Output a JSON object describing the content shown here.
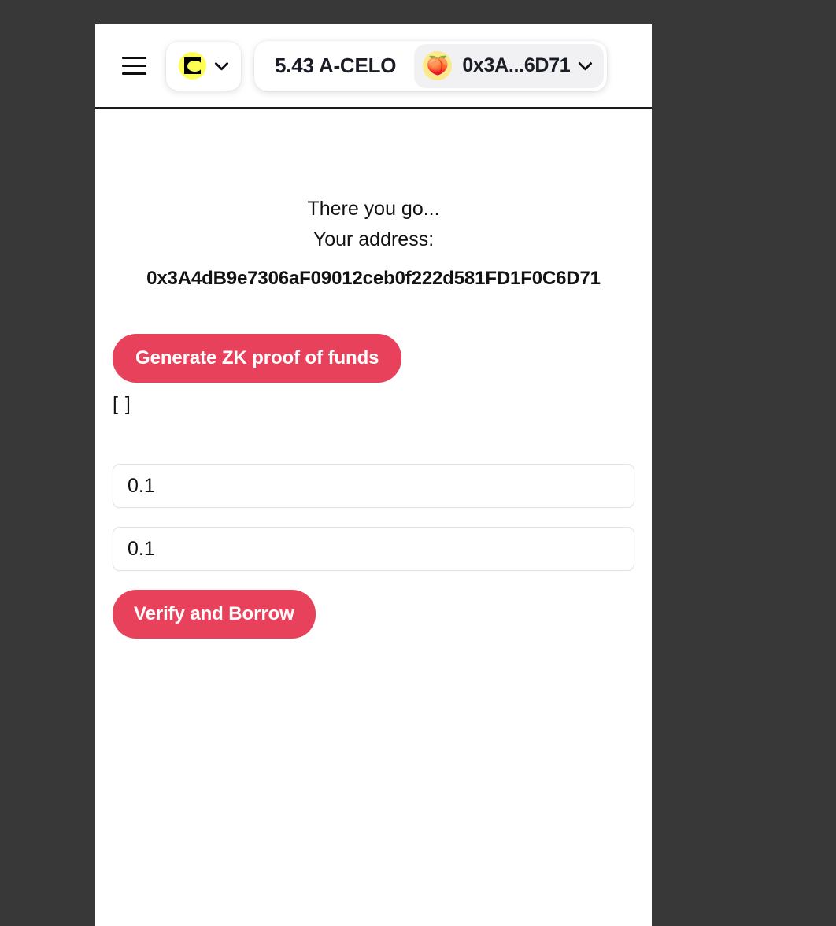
{
  "theme": {
    "page_background": "#FFFFFF",
    "outer_background": "#383838",
    "accent_red": "#E8415C",
    "celo_yellow": "#FCFF52",
    "chip_gray": "#F1F1F3",
    "avatar_yellow": "#FCE98A"
  },
  "header": {
    "menu_button_label": "Menu",
    "menu_icon": "hamburger-icon",
    "network": {
      "logo_icon": "celo-logo-icon",
      "name": "Celo",
      "dropdown_icon": "chevron-down-icon"
    },
    "wallet": {
      "balance": "5.43 A-CELO",
      "avatar_icon": "peach-emoji-avatar",
      "avatar_glyph": "🍑",
      "address_short": "0x3A...6D71",
      "dropdown_icon": "chevron-down-icon"
    }
  },
  "main": {
    "headline_line1": "There you go...",
    "headline_line2": "Your address:",
    "address_full": "0x3A4dB9e7306aF09012ceb0f222d581FD1F0C6D71",
    "generate_proof_label": "Generate ZK proof of funds",
    "proof_output": "[ ]",
    "amount_field": {
      "value": "0.1",
      "placeholder": "0.1"
    },
    "collateral_field": {
      "value": "0.1",
      "placeholder": "0.1"
    },
    "verify_borrow_label": "Verify and Borrow"
  }
}
